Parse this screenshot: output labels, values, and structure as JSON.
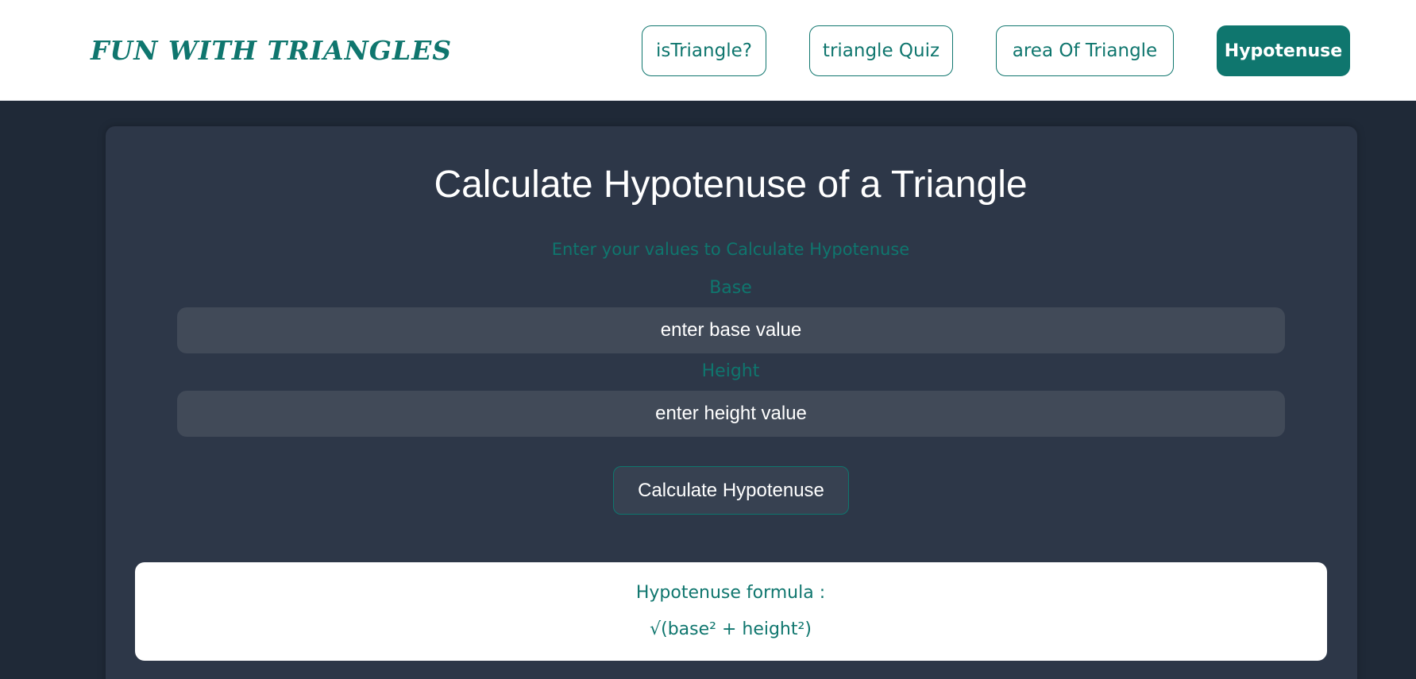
{
  "header": {
    "logo": "FUN WITH TRIANGLES",
    "nav": [
      {
        "label": "isTriangle?",
        "active": false
      },
      {
        "label": "triangle Quiz",
        "active": false
      },
      {
        "label": "area Of Triangle",
        "active": false
      },
      {
        "label": "Hypotenuse",
        "active": true
      }
    ]
  },
  "main": {
    "title": "Calculate Hypotenuse of a Triangle",
    "subtitle": "Enter your values to Calculate Hypotenuse",
    "base": {
      "label": "Base",
      "placeholder": "enter base value",
      "value": ""
    },
    "height": {
      "label": "Height",
      "placeholder": "enter height value",
      "value": ""
    },
    "calculate_label": "Calculate Hypotenuse",
    "formula": {
      "heading": "Hypotenuse formula :",
      "expression": "√(base² + height²)"
    }
  },
  "colors": {
    "accent": "#0f766e",
    "page_bg": "#1f2937",
    "card_bg": "#2d3748",
    "field_bg": "#414a58"
  }
}
